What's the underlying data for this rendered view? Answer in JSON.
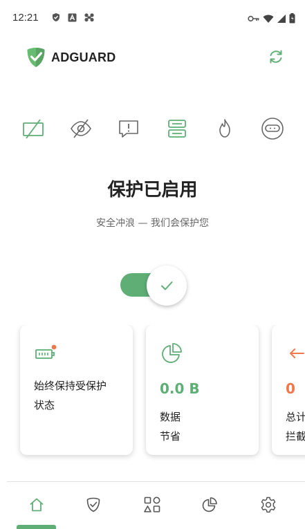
{
  "status_bar": {
    "time": "12:21",
    "left_icons": [
      "shield-status-icon",
      "a-status-icon",
      "drone-status-icon"
    ],
    "right_icons": [
      "key-icon",
      "wifi-icon",
      "signal-icon",
      "battery-icon"
    ]
  },
  "header": {
    "app_name": "ADGUARD",
    "refresh_icon": "refresh-icon"
  },
  "features": [
    {
      "name": "ad-blocking-icon"
    },
    {
      "name": "tracking-protection-icon"
    },
    {
      "name": "annoyance-blocking-icon"
    },
    {
      "name": "dns-protection-icon"
    },
    {
      "name": "firewall-icon"
    },
    {
      "name": "stealth-mode-icon"
    }
  ],
  "main": {
    "title": "保护已启用",
    "subtitle": "安全冲浪 — 我们会保护您",
    "protection_enabled": true
  },
  "cards": [
    {
      "icon": "battery-plugin-icon",
      "text_line1": "始终保持受保护",
      "text_line2": "状态"
    },
    {
      "icon": "pie-chart-icon",
      "value": "0.0 B",
      "label_line1": "数据",
      "label_line2": "节省"
    },
    {
      "icon": "blocked-arrow-icon",
      "value": "0",
      "label_line1": "总计",
      "label_line2": "拦截"
    }
  ],
  "bottom_nav": {
    "items": [
      "home-icon",
      "protection-icon",
      "apps-icon",
      "statistics-icon",
      "settings-icon"
    ],
    "active": "home-icon"
  },
  "colors": {
    "accent": "#5fae76",
    "orange": "#f2784b",
    "text": "#222222",
    "muted": "#666666"
  }
}
